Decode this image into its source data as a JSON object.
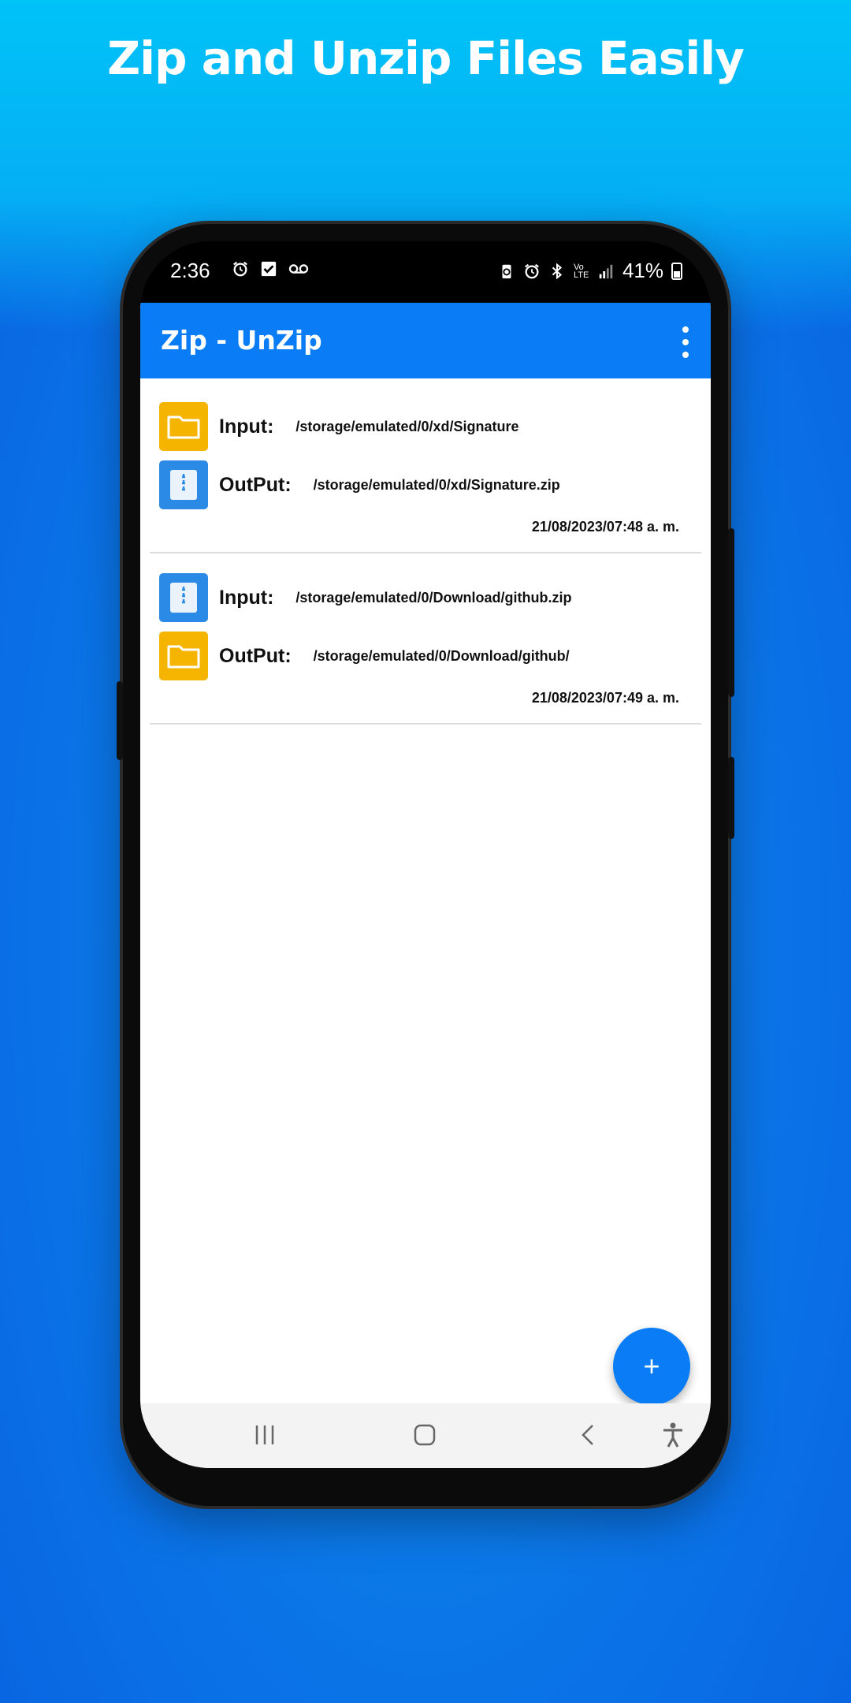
{
  "headline": "Zip and Unzip Files Easily",
  "status_bar": {
    "time": "2:36",
    "battery": "41%",
    "icons_left": [
      "alarm-icon",
      "checkbox-icon",
      "voicemail-icon"
    ],
    "icons_right": [
      "battery-saver-icon",
      "alarm-icon",
      "bluetooth-icon",
      "volte-icon",
      "signal-icon",
      "battery-icon"
    ],
    "volte_text": "Vo LTE"
  },
  "app": {
    "title": "Zip - UnZip",
    "accent_color": "#0a7cf5",
    "folder_color": "#f4b400",
    "zip_color": "#2b8ae6"
  },
  "entries": [
    {
      "input_label": "Input:",
      "input_path": "/storage/emulated/0/xd/Signature",
      "input_icon": "folder-icon",
      "output_label": "OutPut:",
      "output_path": "/storage/emulated/0/xd/Signature.zip",
      "output_icon": "zip-file-icon",
      "date": "21/08/2023/07:48 a. m."
    },
    {
      "input_label": "Input:",
      "input_path": "/storage/emulated/0/Download/github.zip",
      "input_icon": "zip-file-icon",
      "output_label": "OutPut:",
      "output_path": "/storage/emulated/0/Download/github/",
      "output_icon": "folder-icon",
      "date": "21/08/2023/07:49 a. m."
    }
  ],
  "fab": {
    "symbol": "+"
  },
  "nav": [
    "recents-icon",
    "home-icon",
    "back-icon",
    "accessibility-icon"
  ]
}
